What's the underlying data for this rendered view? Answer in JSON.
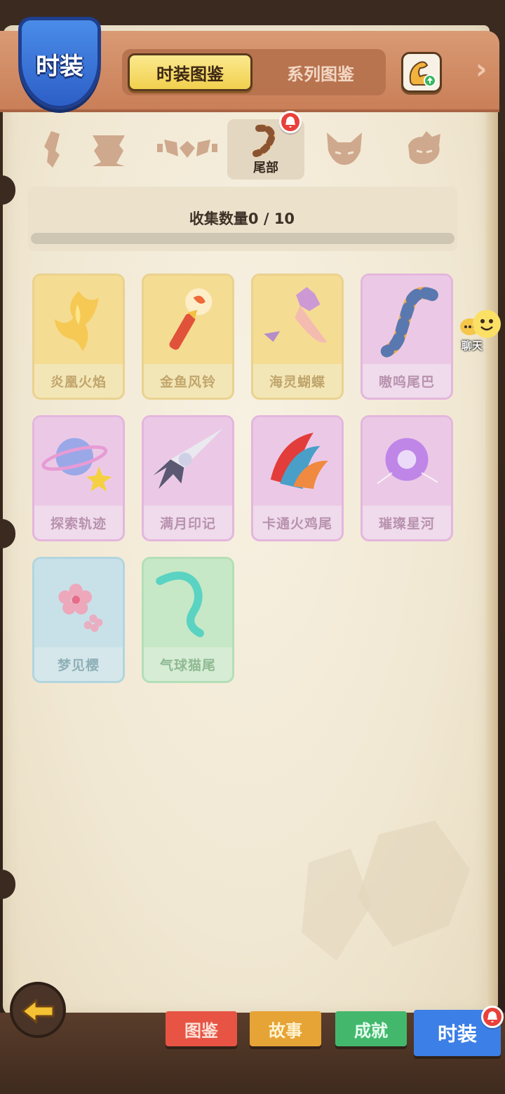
{
  "header": {
    "shield_title": "时装",
    "tab_active": "时装图鉴",
    "tab_inactive": "系列图鉴"
  },
  "categories": [
    {
      "name": "weapon",
      "label": ""
    },
    {
      "name": "body",
      "label": ""
    },
    {
      "name": "wings",
      "label": ""
    },
    {
      "name": "tail",
      "label": "尾部",
      "active": true,
      "badge": true
    },
    {
      "name": "face",
      "label": ""
    },
    {
      "name": "head",
      "label": ""
    }
  ],
  "collection": {
    "text": "收集数量0 / 10",
    "collected": 0,
    "total": 10
  },
  "items": [
    {
      "name": "炎凰火焰",
      "rarity": "gold"
    },
    {
      "name": "金鱼风铃",
      "rarity": "gold"
    },
    {
      "name": "海灵蝴蝶",
      "rarity": "gold"
    },
    {
      "name": "嗷呜尾巴",
      "rarity": "pink"
    },
    {
      "name": "探索轨迹",
      "rarity": "pink"
    },
    {
      "name": "满月印记",
      "rarity": "pink"
    },
    {
      "name": "卡通火鸡尾",
      "rarity": "pink"
    },
    {
      "name": "璀璨星河",
      "rarity": "pink"
    },
    {
      "name": "梦见樱",
      "rarity": "blue"
    },
    {
      "name": "气球猫尾",
      "rarity": "green"
    }
  ],
  "chat": {
    "label": "聊天"
  },
  "bottom_tabs": [
    "图鉴",
    "故事",
    "成就",
    "时装"
  ],
  "colors": {
    "accent_yellow": "#f1d04e",
    "shield_blue": "#2d5fc7",
    "badge_red": "#e8413a",
    "parchment": "#f1e8d3"
  }
}
